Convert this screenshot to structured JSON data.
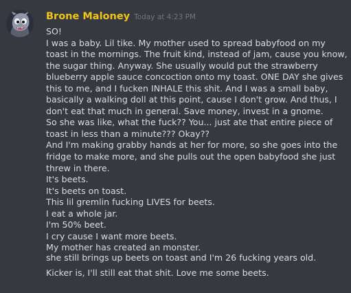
{
  "message": {
    "username": "Brone Maloney",
    "timestamp": "Today at 4:23 PM",
    "avatar": "monster-avatar-icon",
    "colors": {
      "background": "#36393f",
      "username": "#f0c419",
      "text": "#dcddde",
      "timestamp": "#72767d"
    },
    "lines": [
      "SO!",
      "I was a baby. Lil tike. My mother used to spread babyfood on my",
      "toast in the mornings. The fruit kind, instead of jam, cause you know,",
      "the sugar thing. Anyway. She usually would put the strawberry",
      "blueberry apple sauce concoction onto my toast. ONE DAY she gives",
      "this to me, and I fucken INHALE this shit. And I was a small baby,",
      "basically a walking doll at this point, cause I don't grow. And thus, I",
      "don't eat that much in general. Save money, invest in a gnome.",
      "So she was like, what the fuck?? You... just ate that entire piece of",
      "toast in less than a minute??? Okay??",
      "And I'm making grabby hands at her for more, so she goes into the",
      "fridge to make more, and she pulls out the open babyfood she just",
      "threw in there.",
      "It's beets.",
      "It's beets on toast.",
      "This lil gremlin fucking LIVES for beets.",
      "I eat a whole jar.",
      "I'm 50% beet.",
      "I cry cause I want more beets.",
      "My mother has created an monster."
    ],
    "followups": [
      "she still brings up beets on toast and I'm 26 fucking years old.",
      "Kicker is, I'll still eat that shit. Love me some beets."
    ]
  }
}
